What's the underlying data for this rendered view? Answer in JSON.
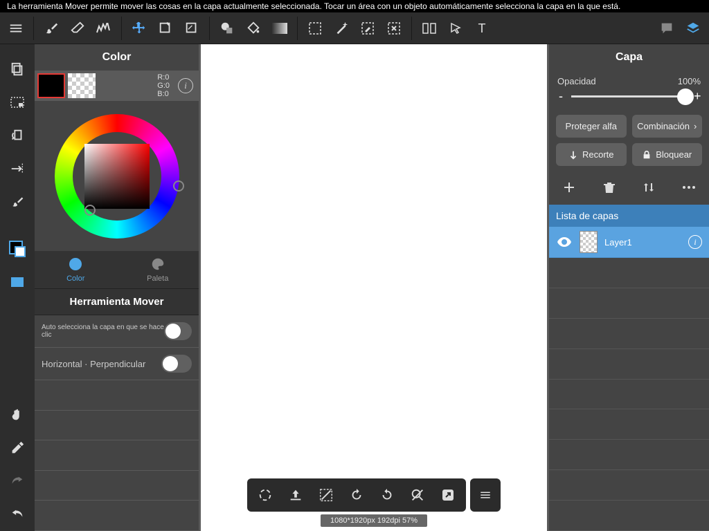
{
  "tooltip": "La herramienta Mover permite mover las cosas en la capa actualmente seleccionada. Tocar un área con un objeto automáticamente selecciona la capa en la que está.",
  "color_panel": {
    "title": "Color",
    "rgb": {
      "r": "R:0",
      "g": "G:0",
      "b": "B:0"
    },
    "tabs": {
      "color": "Color",
      "palette": "Paleta"
    }
  },
  "tool_section": {
    "title": "Herramienta Mover",
    "auto_select": "Auto selecciona la capa en que se hace clic",
    "horiz_perp": "Horizontal · Perpendicular"
  },
  "layer_panel": {
    "title": "Capa",
    "opacity_label": "Opacidad",
    "opacity_value": "100%",
    "protect_alpha": "Proteger alfa",
    "blend": "Combinación",
    "clip": "Recorte",
    "lock": "Bloquear",
    "list_header": "Lista de capas",
    "layer1": "Layer1"
  },
  "status": "1080*1920px 192dpi 57%"
}
